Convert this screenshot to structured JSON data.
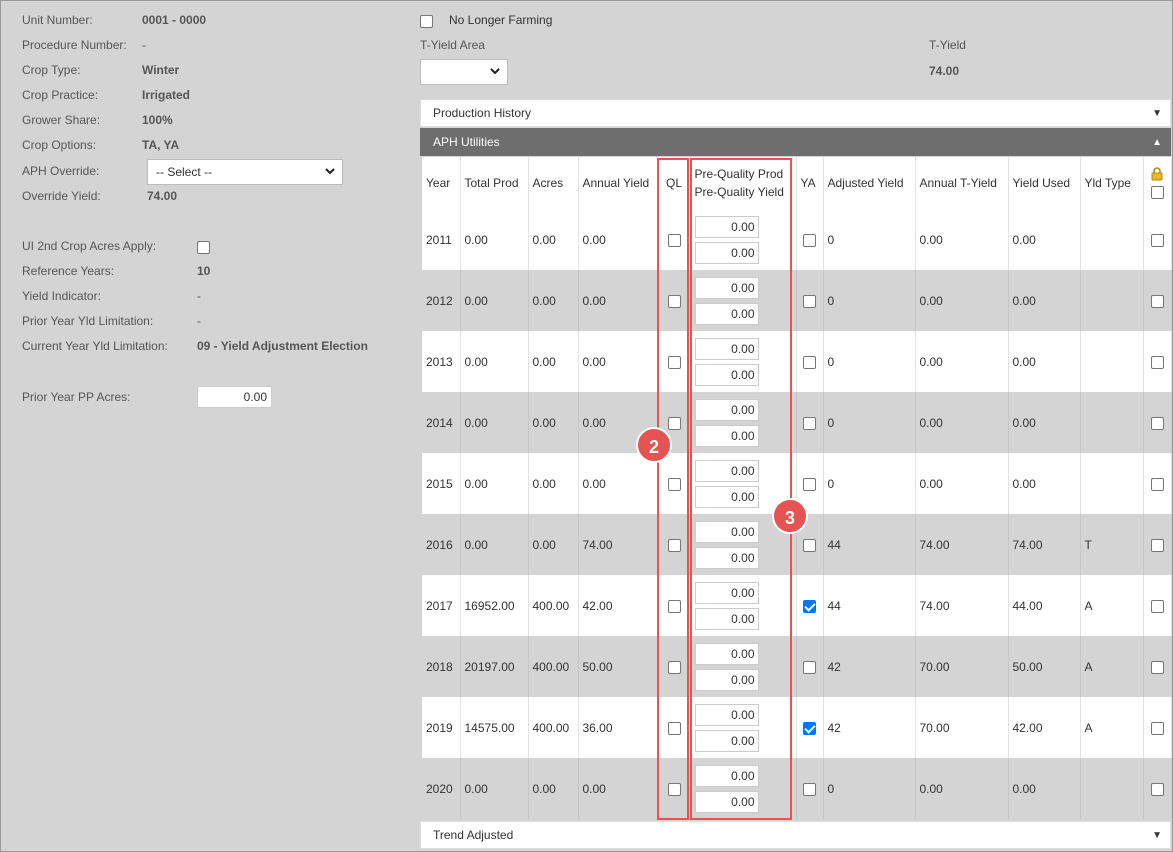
{
  "info": {
    "unit_number": {
      "label": "Unit Number:",
      "value": "0001 - 0000"
    },
    "procedure_number": {
      "label": "Procedure Number:",
      "value": "-"
    },
    "crop_type": {
      "label": "Crop Type:",
      "value": "Winter"
    },
    "crop_practice": {
      "label": "Crop Practice:",
      "value": "Irrigated"
    },
    "grower_share": {
      "label": "Grower Share:",
      "value": "100%"
    },
    "crop_options": {
      "label": "Crop Options:",
      "value": "TA, YA"
    },
    "aph_override": {
      "label": "APH Override:",
      "value": "-- Select --"
    },
    "override_yield": {
      "label": "Override Yield:",
      "value": "74.00"
    },
    "ui_2nd_crop": {
      "label": "UI 2nd Crop Acres Apply:"
    },
    "reference_years": {
      "label": "Reference Years:",
      "value": "10"
    },
    "yield_indicator": {
      "label": "Yield Indicator:",
      "value": "-"
    },
    "prior_year_limit": {
      "label": "Prior Year Yld Limitation:",
      "value": "-"
    },
    "current_year_limit": {
      "label": "Current Year Yld Limitation:",
      "value": "09 - Yield Adjustment Election"
    },
    "prior_pp_acres": {
      "label": "Prior Year PP Acres:",
      "value": "0.00"
    }
  },
  "top": {
    "no_longer_farming": "No Longer Farming",
    "t_yield_area_label": "T-Yield Area",
    "t_yield_label": "T-Yield",
    "t_yield_value": "74.00"
  },
  "sections": {
    "production_history": "Production History",
    "aph_utilities": "APH Utilities",
    "trend_adjusted": "Trend Adjusted"
  },
  "table": {
    "headers": {
      "year": "Year",
      "total_prod": "Total Prod",
      "acres": "Acres",
      "annual_yield": "Annual Yield",
      "ql": "QL",
      "pq_prod": "Pre-Quality Prod",
      "pq_yield": "Pre-Quality Yield",
      "ya": "YA",
      "adjusted_yield": "Adjusted Yield",
      "annual_t_yield": "Annual T-Yield",
      "yield_used": "Yield Used",
      "yld_type": "Yld Type"
    },
    "rows": [
      {
        "year": "2011",
        "total_prod": "0.00",
        "acres": "0.00",
        "annual_yield": "0.00",
        "pq_prod": "0.00",
        "pq_yield": "0.00",
        "ya": false,
        "adjusted_yield": "0",
        "annual_t_yield": "0.00",
        "yield_used": "0.00",
        "yld_type": ""
      },
      {
        "year": "2012",
        "total_prod": "0.00",
        "acres": "0.00",
        "annual_yield": "0.00",
        "pq_prod": "0.00",
        "pq_yield": "0.00",
        "ya": false,
        "adjusted_yield": "0",
        "annual_t_yield": "0.00",
        "yield_used": "0.00",
        "yld_type": ""
      },
      {
        "year": "2013",
        "total_prod": "0.00",
        "acres": "0.00",
        "annual_yield": "0.00",
        "pq_prod": "0.00",
        "pq_yield": "0.00",
        "ya": false,
        "adjusted_yield": "0",
        "annual_t_yield": "0.00",
        "yield_used": "0.00",
        "yld_type": ""
      },
      {
        "year": "2014",
        "total_prod": "0.00",
        "acres": "0.00",
        "annual_yield": "0.00",
        "pq_prod": "0.00",
        "pq_yield": "0.00",
        "ya": false,
        "adjusted_yield": "0",
        "annual_t_yield": "0.00",
        "yield_used": "0.00",
        "yld_type": ""
      },
      {
        "year": "2015",
        "total_prod": "0.00",
        "acres": "0.00",
        "annual_yield": "0.00",
        "pq_prod": "0.00",
        "pq_yield": "0.00",
        "ya": false,
        "adjusted_yield": "0",
        "annual_t_yield": "0.00",
        "yield_used": "0.00",
        "yld_type": ""
      },
      {
        "year": "2016",
        "total_prod": "0.00",
        "acres": "0.00",
        "annual_yield": "74.00",
        "pq_prod": "0.00",
        "pq_yield": "0.00",
        "ya": false,
        "adjusted_yield": "44",
        "annual_t_yield": "74.00",
        "yield_used": "74.00",
        "yld_type": "T"
      },
      {
        "year": "2017",
        "total_prod": "16952.00",
        "acres": "400.00",
        "annual_yield": "42.00",
        "pq_prod": "0.00",
        "pq_yield": "0.00",
        "ya": true,
        "adjusted_yield": "44",
        "annual_t_yield": "74.00",
        "yield_used": "44.00",
        "yld_type": "A"
      },
      {
        "year": "2018",
        "total_prod": "20197.00",
        "acres": "400.00",
        "annual_yield": "50.00",
        "pq_prod": "0.00",
        "pq_yield": "0.00",
        "ya": false,
        "adjusted_yield": "42",
        "annual_t_yield": "70.00",
        "yield_used": "50.00",
        "yld_type": "A"
      },
      {
        "year": "2019",
        "total_prod": "14575.00",
        "acres": "400.00",
        "annual_yield": "36.00",
        "pq_prod": "0.00",
        "pq_yield": "0.00",
        "ya": true,
        "adjusted_yield": "42",
        "annual_t_yield": "70.00",
        "yield_used": "42.00",
        "yld_type": "A"
      },
      {
        "year": "2020",
        "total_prod": "0.00",
        "acres": "0.00",
        "annual_yield": "0.00",
        "pq_prod": "0.00",
        "pq_yield": "0.00",
        "ya": false,
        "adjusted_yield": "0",
        "annual_t_yield": "0.00",
        "yield_used": "0.00",
        "yld_type": ""
      }
    ]
  },
  "callouts": {
    "ql_marker": "2",
    "pq_marker": "3"
  },
  "colors": {
    "accent_blue": "#0075ff",
    "callout_red": "#e55353",
    "section_header": "#6e6e6e"
  }
}
